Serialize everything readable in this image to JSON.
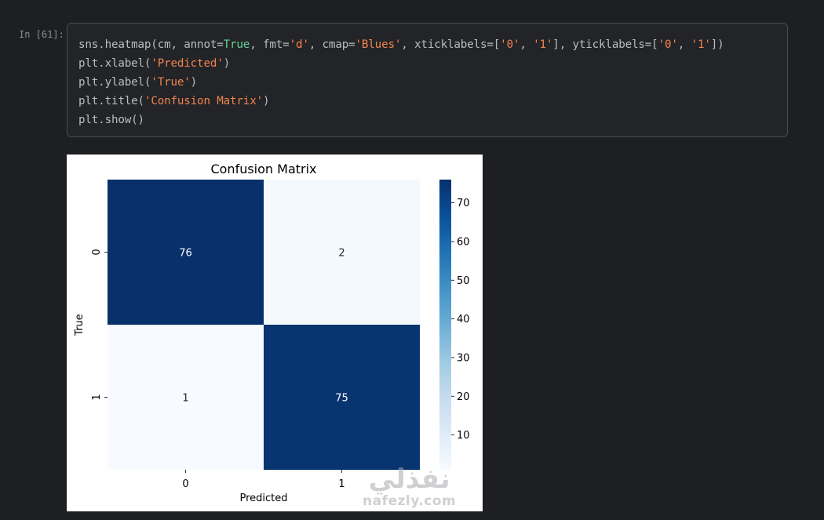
{
  "cell": {
    "prompt": "In [61]:",
    "code_lines": [
      [
        {
          "t": "sns.heatmap(cm, annot=",
          "c": "p"
        },
        {
          "t": "True",
          "c": "k"
        },
        {
          "t": ", fmt=",
          "c": "p"
        },
        {
          "t": "'d'",
          "c": "s"
        },
        {
          "t": ", cmap=",
          "c": "p"
        },
        {
          "t": "'Blues'",
          "c": "s"
        },
        {
          "t": ", xticklabels=[",
          "c": "p"
        },
        {
          "t": "'0'",
          "c": "s"
        },
        {
          "t": ", ",
          "c": "p"
        },
        {
          "t": "'1'",
          "c": "s"
        },
        {
          "t": "], yticklabels=[",
          "c": "p"
        },
        {
          "t": "'0'",
          "c": "s"
        },
        {
          "t": ", ",
          "c": "p"
        },
        {
          "t": "'1'",
          "c": "s"
        },
        {
          "t": "])",
          "c": "p"
        }
      ],
      [
        {
          "t": "plt.xlabel(",
          "c": "p"
        },
        {
          "t": "'Predicted'",
          "c": "s"
        },
        {
          "t": ")",
          "c": "p"
        }
      ],
      [
        {
          "t": "plt.ylabel(",
          "c": "p"
        },
        {
          "t": "'True'",
          "c": "s"
        },
        {
          "t": ")",
          "c": "p"
        }
      ],
      [
        {
          "t": "plt.title(",
          "c": "p"
        },
        {
          "t": "'Confusion Matrix'",
          "c": "s"
        },
        {
          "t": ")",
          "c": "p"
        }
      ],
      [
        {
          "t": "plt.show()",
          "c": "p"
        }
      ]
    ]
  },
  "chart_data": {
    "type": "heatmap",
    "title": "Confusion Matrix",
    "xlabel": "Predicted",
    "ylabel": "True",
    "x_categories": [
      "0",
      "1"
    ],
    "y_categories": [
      "0",
      "1"
    ],
    "values": [
      [
        76,
        2
      ],
      [
        1,
        75
      ]
    ],
    "colormap": "Blues",
    "colorbar": {
      "range": [
        1,
        76
      ],
      "ticks": [
        10,
        20,
        30,
        40,
        50,
        60,
        70
      ]
    }
  },
  "watermark": {
    "arabic": "نفذلي",
    "latin": "nafezly.com"
  }
}
